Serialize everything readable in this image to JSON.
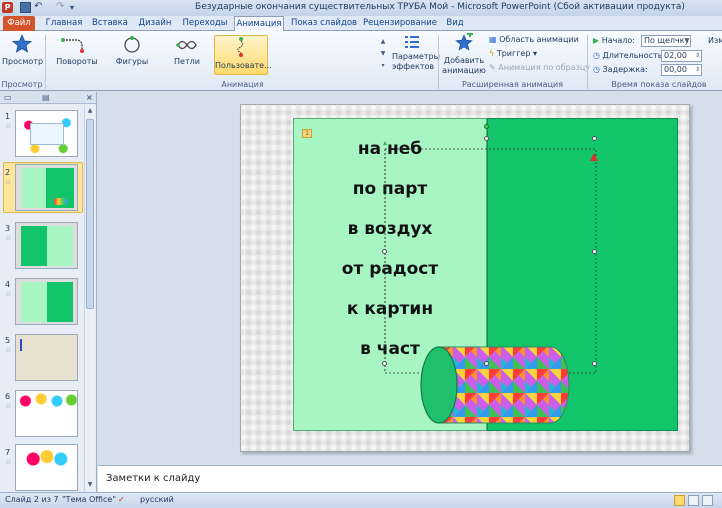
{
  "window": {
    "title": "Безударные окончания существительных ТРУБА  Мой  -  Microsoft PowerPoint (Сбой активации продукта)"
  },
  "quick_access": {
    "app_icon": "powerpoint-icon",
    "save_icon": "save-icon",
    "undo_icon": "undo-icon",
    "redo_icon": "redo-icon",
    "customize_icon": "chevron-down-icon"
  },
  "tabs": [
    {
      "label": "Файл"
    },
    {
      "label": "Главная"
    },
    {
      "label": "Вставка"
    },
    {
      "label": "Дизайн"
    },
    {
      "label": "Переходы"
    },
    {
      "label": "Анимация"
    },
    {
      "label": "Показ слайдов"
    },
    {
      "label": "Рецензирование"
    },
    {
      "label": "Вид"
    }
  ],
  "ribbon": {
    "preview": {
      "button_label": "Просмотр",
      "group_label": "Просмотр"
    },
    "animation": {
      "items": [
        {
          "label": "Повороты"
        },
        {
          "label": "Фигуры"
        },
        {
          "label": "Петли"
        },
        {
          "label": "Пользовате..."
        }
      ],
      "group_label": "Анимация",
      "effect_options_line1": "Параметры",
      "effect_options_line2": "эффектов"
    },
    "advanced": {
      "add_line1": "Добавить",
      "add_line2": "анимацию",
      "pane": "Область анимации",
      "trigger": "Триггер",
      "painter": "Анимация по образцу",
      "group_label": "Расширенная анимация"
    },
    "timing": {
      "start_label": "Начало:",
      "start_value": "По щелчку",
      "duration_label": "Длительность:",
      "duration_value": "02,00",
      "delay_label": "Задержка:",
      "delay_value": "00,00",
      "group_label": "Время показа слайдов",
      "cut_label": "Изм"
    }
  },
  "thumbnails": [
    {
      "num": "1"
    },
    {
      "num": "2"
    },
    {
      "num": "3"
    },
    {
      "num": "4"
    },
    {
      "num": "5"
    },
    {
      "num": "6"
    },
    {
      "num": "7"
    }
  ],
  "slide": {
    "anim_tag": "1",
    "words": [
      "на неб",
      "по парт",
      "в воздух",
      "от радост",
      "к картин",
      "в част"
    ]
  },
  "notes": {
    "placeholder": "Заметки к слайду"
  },
  "status": {
    "slide_info": "Слайд 2 из 7",
    "theme": "\"Тема Office\"",
    "language": "русский"
  },
  "colors": {
    "panel_light": "#a8f5c4",
    "panel_dark": "#12c46a",
    "file_tab": "#d4542c",
    "ribbon_selected": "#ffd96b"
  }
}
